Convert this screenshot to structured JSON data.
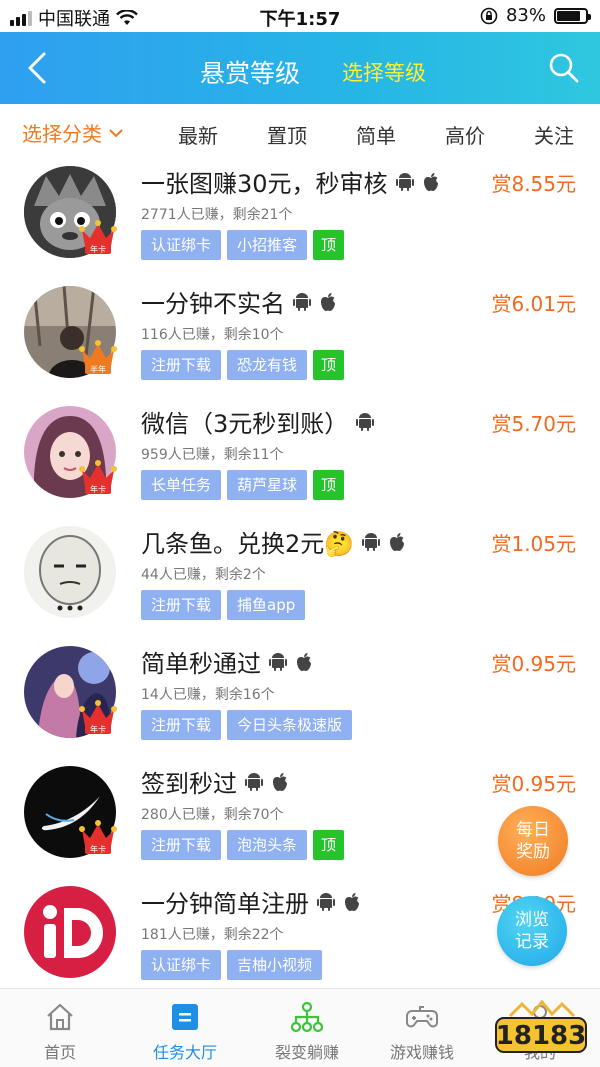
{
  "status_bar": {
    "carrier": "中国联通",
    "time": "下午1:57",
    "battery": "83%",
    "battery_fraction": 0.83
  },
  "nav": {
    "title": "悬赏等级",
    "select_level": "选择等级",
    "back_icon": "back-chevron-icon",
    "search_icon": "search-icon"
  },
  "filter": {
    "category": "选择分类",
    "tabs": [
      "最新",
      "置顶",
      "简单",
      "高价",
      "关注"
    ]
  },
  "tasks": [
    {
      "title": "一张图赚30元，秒审核",
      "reward": "赏8.55元",
      "stats": "2771人已赚，剩余21个",
      "tags": [
        "认证绑卡",
        "小招推客"
      ],
      "top": "顶",
      "badge": "年卡",
      "android": true,
      "apple": true
    },
    {
      "title": "一分钟不实名",
      "reward": "赏6.01元",
      "stats": "116人已赚，剩余10个",
      "tags": [
        "注册下载",
        "恐龙有钱"
      ],
      "top": "顶",
      "badge": "半年",
      "android": true,
      "apple": true
    },
    {
      "title": "微信（3元秒到账）",
      "reward": "赏5.70元",
      "stats": "959人已赚，剩余11个",
      "tags": [
        "长单任务",
        "葫芦星球"
      ],
      "top": "顶",
      "badge": "年卡",
      "android": true,
      "apple": false
    },
    {
      "title": "几条鱼。兑换2元🤔",
      "reward": "赏1.05元",
      "stats": "44人已赚，剩余2个",
      "tags": [
        "注册下载",
        "捕鱼app"
      ],
      "top": "",
      "badge": "",
      "android": true,
      "apple": true
    },
    {
      "title": "简单秒通过",
      "reward": "赏0.95元",
      "stats": "14人已赚，剩余16个",
      "tags": [
        "注册下载",
        "今日头条极速版"
      ],
      "top": "",
      "badge": "年卡",
      "android": true,
      "apple": true
    },
    {
      "title": "签到秒过",
      "reward": "赏0.95元",
      "stats": "280人已赚，剩余70个",
      "tags": [
        "注册下载",
        "泡泡头条"
      ],
      "top": "顶",
      "badge": "年卡",
      "android": true,
      "apple": true
    },
    {
      "title": "一分钟简单注册",
      "reward": "赏8.10元",
      "stats": "181人已赚，剩余22个",
      "tags": [
        "认证绑卡",
        "吉柚小视频"
      ],
      "top": "",
      "badge": "",
      "android": true,
      "apple": true
    }
  ],
  "floating": {
    "daily_line1": "每日",
    "daily_line2": "奖励",
    "history_line1": "浏览",
    "history_line2": "记录"
  },
  "tabbar": [
    {
      "label": "首页",
      "icon": "home-icon"
    },
    {
      "label": "任务大厅",
      "icon": "task-hall-icon"
    },
    {
      "label": "裂变躺赚",
      "icon": "network-icon"
    },
    {
      "label": "游戏赚钱",
      "icon": "gamepad-icon"
    },
    {
      "label": "我的",
      "icon": "profile-icon"
    }
  ],
  "watermark": "18183",
  "colors": {
    "nav_gradient_start": "#2f9ff0",
    "accent_orange": "#f07a21",
    "tag_blue": "#8fb0f1",
    "tag_green": "#26c42b",
    "active_blue": "#1f8fe6"
  }
}
